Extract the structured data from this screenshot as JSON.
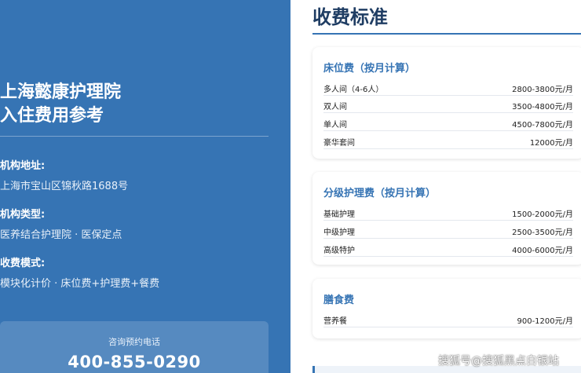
{
  "left": {
    "title_line1": "上海懿康护理院",
    "title_line2": "入住费用参考",
    "address_label": "机构地址:",
    "address_value": "上海市宝山区锦秋路1688号",
    "type_label": "机构类型:",
    "type_value": "医养结合护理院 · 医保定点",
    "mode_label": "收费模式:",
    "mode_value": "模块化计价 · 床位费+护理费+餐费",
    "contact_label": "咨询预约电话",
    "contact_phone": "400-855-0290"
  },
  "right": {
    "title": "收费标准",
    "bed": {
      "title": "床位费（按月计算）",
      "rows": [
        {
          "name": "多人间（4-6人）",
          "price": "2800-3800元/月"
        },
        {
          "name": "双人间",
          "price": "3500-4800元/月"
        },
        {
          "name": "单人间",
          "price": "4500-7800元/月"
        },
        {
          "name": "豪华套间",
          "price": "12000元/月"
        }
      ]
    },
    "care": {
      "title": "分级护理费（按月计算）",
      "rows": [
        {
          "name": "基础护理",
          "price": "1500-2000元/月"
        },
        {
          "name": "中级护理",
          "price": "2500-3500元/月"
        },
        {
          "name": "高级特护",
          "price": "4000-6000元/月"
        }
      ]
    },
    "meal": {
      "title": "膳食费",
      "rows": [
        {
          "name": "营养餐",
          "price": "900-1200元/月"
        }
      ]
    }
  },
  "watermark": "搜狐号@搜狐黑点白银站"
}
